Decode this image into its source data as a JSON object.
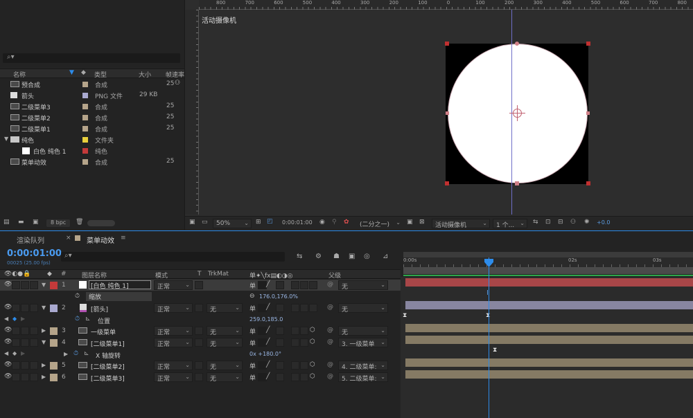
{
  "project": {
    "search_icon": "search-icon",
    "columns": {
      "name": "名称",
      "type": "类型",
      "size": "大小",
      "fps": "帧速率"
    },
    "items": [
      {
        "name": "预合成",
        "type": "合成",
        "size": "",
        "fps": "25",
        "indent": 0,
        "color": "#b5a48a",
        "icon": "composition-icon"
      },
      {
        "name": "箭头",
        "type": "PNG 文件",
        "size": "29 KB",
        "fps": "",
        "indent": 0,
        "color": "#a9a9cf",
        "icon": "png-file-icon"
      },
      {
        "name": "二级菜单3",
        "type": "合成",
        "size": "",
        "fps": "25",
        "indent": 0,
        "color": "#b5a48a",
        "icon": "composition-icon"
      },
      {
        "name": "二级菜单2",
        "type": "合成",
        "size": "",
        "fps": "25",
        "indent": 0,
        "color": "#b5a48a",
        "icon": "composition-icon"
      },
      {
        "name": "二级菜单1",
        "type": "合成",
        "size": "",
        "fps": "25",
        "indent": 0,
        "color": "#b5a48a",
        "icon": "composition-icon"
      },
      {
        "name": "纯色",
        "type": "文件夹",
        "size": "",
        "fps": "",
        "indent": 0,
        "color": "#e8cf3c",
        "icon": "folder-icon"
      },
      {
        "name": "白色 纯色 1",
        "type": "纯色",
        "size": "",
        "fps": "",
        "indent": 1,
        "color": "#c43a3a",
        "icon": "solid-icon"
      },
      {
        "name": "菜单动效",
        "type": "合成",
        "size": "",
        "fps": "25",
        "indent": 0,
        "color": "#b5a48a",
        "icon": "composition-icon"
      }
    ],
    "bpc": "8 bpc"
  },
  "viewer": {
    "ruler": [
      "800",
      "700",
      "600",
      "500",
      "400",
      "300",
      "200",
      "100",
      "0",
      "100",
      "200",
      "300",
      "400",
      "500",
      "600",
      "700",
      "800"
    ],
    "camera_label": "活动摄像机",
    "zoom": "50%",
    "timecode": "0:00:01:00",
    "resolution": "(二分之一)",
    "camera": "活动摄像机",
    "views": "1 个...",
    "exposure": "+0.0"
  },
  "timeline": {
    "tabs": [
      "渲染队列",
      "菜单动效"
    ],
    "timecode": "0:00:01:00",
    "frame_info": "00025 (25.00 fps)",
    "headers": {
      "num": "#",
      "name": "图层名称",
      "mode": "模式",
      "t": "T",
      "trkmat": "TrkMat",
      "parent": "父级"
    },
    "ruler": [
      "0:00s",
      "02s",
      "03s"
    ],
    "layers": [
      {
        "num": "1",
        "name": "[白色 纯色 1]",
        "mode": "正常",
        "trk": "",
        "parent": "无",
        "color": "#c43a3a",
        "expanded": true,
        "kind": "solid"
      },
      {
        "num": "2",
        "name": "[箭头]",
        "mode": "正常",
        "trk": "无",
        "parent": "无",
        "color": "#a9a9cf",
        "expanded": true,
        "kind": "png"
      },
      {
        "num": "3",
        "name": "一级菜单",
        "mode": "正常",
        "trk": "无",
        "parent": "无",
        "color": "#b5a48a",
        "expanded": false,
        "kind": "comp"
      },
      {
        "num": "4",
        "name": "[二级菜单1]",
        "mode": "正常",
        "trk": "无",
        "parent": "3. 一级菜单",
        "color": "#b5a48a",
        "expanded": true,
        "kind": "comp"
      },
      {
        "num": "5",
        "name": "[二级菜单2]",
        "mode": "正常",
        "trk": "无",
        "parent": "4. 二级菜单:",
        "color": "#b5a48a",
        "expanded": false,
        "kind": "comp"
      },
      {
        "num": "6",
        "name": "[二级菜单3]",
        "mode": "正常",
        "trk": "无",
        "parent": "5. 二级菜单:",
        "color": "#b5a48a",
        "expanded": false,
        "kind": "comp"
      }
    ],
    "props": {
      "scale": {
        "name": "缩放",
        "value": "176.0,176.0%"
      },
      "position": {
        "name": "位置",
        "value": "259.0,185.0"
      },
      "xrot": {
        "name": "X 轴旋转",
        "value": "0x +180.0°"
      }
    },
    "bar_colors": {
      "red": "#a84648",
      "lav": "#8886a0",
      "tan": "#857a64"
    }
  }
}
